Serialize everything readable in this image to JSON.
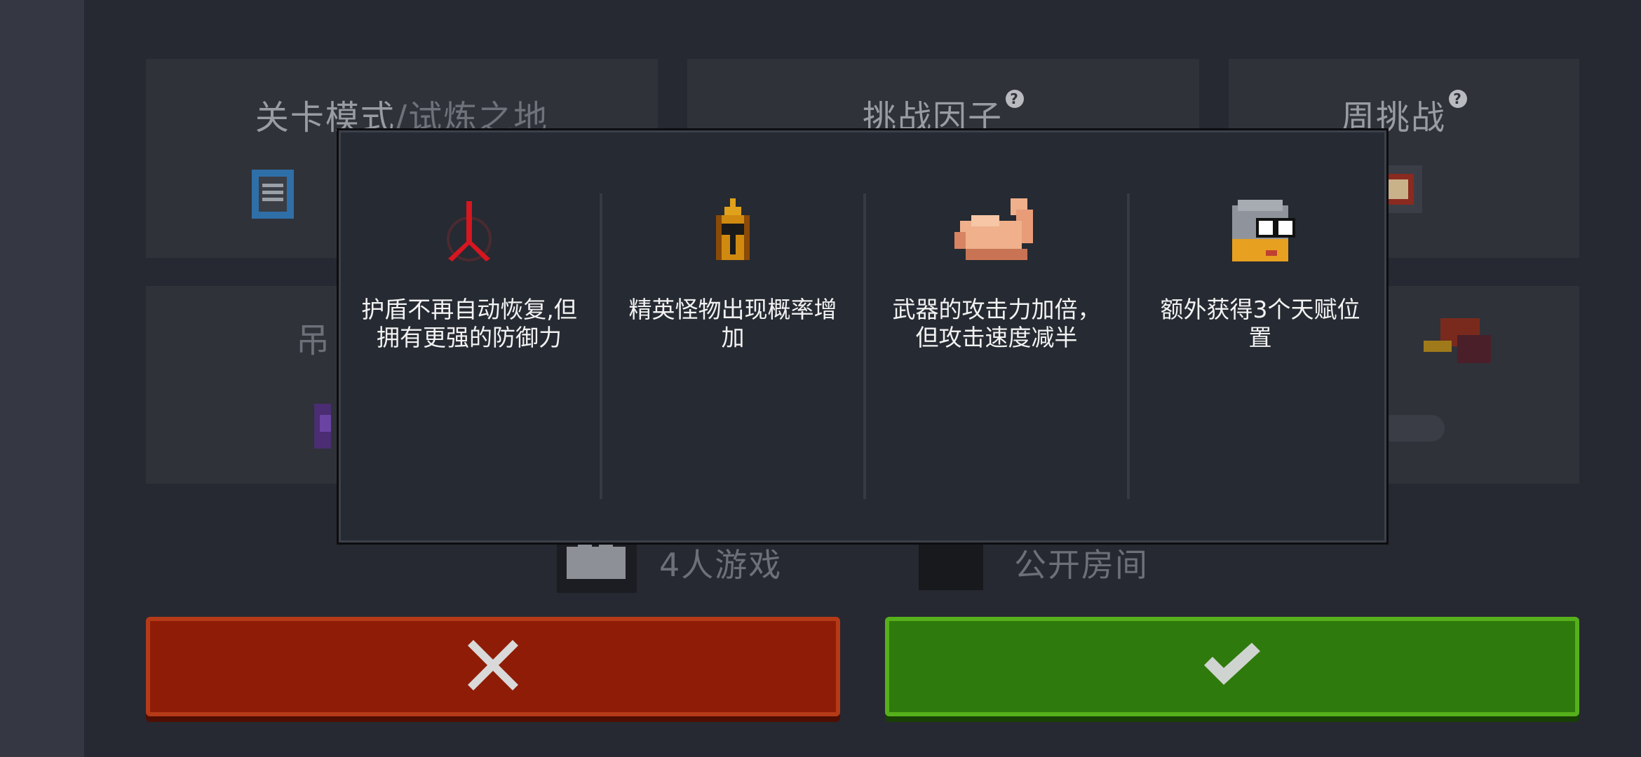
{
  "panels": {
    "stage_mode": {
      "title": "关卡模式",
      "separator": "/",
      "subtitle": "试炼之地"
    },
    "challenge_factor": {
      "title": "挑战因子"
    },
    "weekly_challenge": {
      "title": "周挑战"
    },
    "hidden_left_char": "吊"
  },
  "bottom_row": {
    "players_label": "4人游戏",
    "public_room_label": "公开房间"
  },
  "buttons": {
    "cancel_icon": "close-x-icon",
    "confirm_icon": "checkmark-icon"
  },
  "factors": [
    {
      "icon": "red-rune-icon",
      "text": "护盾不再自动恢复,但拥有更强的防御力"
    },
    {
      "icon": "golden-helmet-icon",
      "text": "精英怪物出现概率增加"
    },
    {
      "icon": "flexing-arm-icon",
      "text": "武器的攻击力加倍，但攻击速度减半"
    },
    {
      "icon": "helmet-glasses-icon",
      "text": "额外获得3个天赋位置"
    }
  ],
  "colors": {
    "cancel": "#8f1c06",
    "confirm": "#2f7a0c",
    "overlay": "#262a32"
  }
}
